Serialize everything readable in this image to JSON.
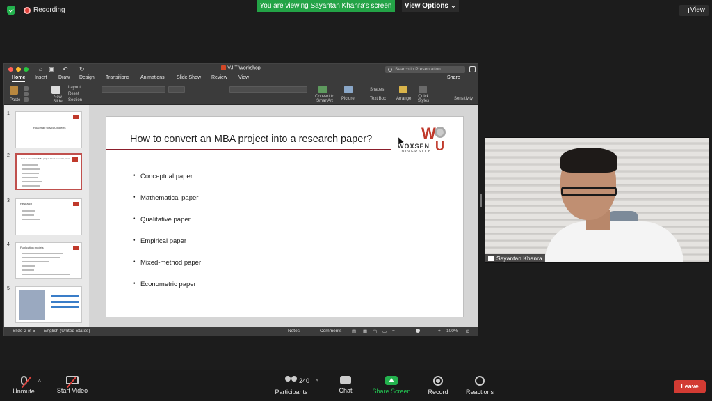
{
  "zoom": {
    "recording_label": "Recording",
    "viewing_banner": "You are viewing Sayantan Khanra's screen",
    "view_options": "View Options ⌄",
    "view_button": "View",
    "participant_count": "240",
    "toolbar": {
      "unmute": "Unmute",
      "start_video": "Start Video",
      "participants": "Participants",
      "chat": "Chat",
      "share_screen": "Share Screen",
      "record": "Record",
      "reactions": "Reactions",
      "leave": "Leave"
    },
    "video_name": "Sayantan Khanra"
  },
  "ppt": {
    "window_title": "VJIT Workshop",
    "search_placeholder": "Search in Presentation",
    "share": "Share",
    "tabs": [
      "Home",
      "Insert",
      "Draw",
      "Design",
      "Transitions",
      "Animations",
      "Slide Show",
      "Review",
      "View"
    ],
    "ribbon": {
      "paste": "Paste",
      "new_slide": "New Slide",
      "layout": "Layout",
      "reset": "Reset",
      "section": "Section",
      "convert": "Convert to SmartArt",
      "picture": "Picture",
      "shapes": "Shapes",
      "text_box": "Text Box",
      "arrange": "Arrange",
      "quick_styles": "Quick Styles",
      "sensitivity": "Sensitivity"
    },
    "thumb_numbers": [
      "1",
      "2",
      "3",
      "4",
      "5"
    ],
    "thumb1_title": "Roadmap to MBA projects",
    "thumb2_title": "How to convert an MBA project into a research paper?",
    "thumb3_title": "Research",
    "thumb4_title": "Publication models",
    "slide": {
      "title": "How to convert an MBA project into a research paper?",
      "logo_name": "WOXSEN",
      "logo_sub": "UNIVERSITY",
      "bullets": [
        "Conceptual paper",
        "Mathematical paper",
        "Qualitative paper",
        "Empirical paper",
        "Mixed-method paper",
        "Econometric paper"
      ]
    },
    "status": {
      "slide_of": "Slide 2 of 5",
      "language": "English (United States)",
      "notes": "Notes",
      "comments": "Comments",
      "zoom": "100%"
    }
  },
  "colors": {
    "zoom_green": "#23a346",
    "leave_red": "#d23b33",
    "woxsen_red": "#c0392b"
  }
}
